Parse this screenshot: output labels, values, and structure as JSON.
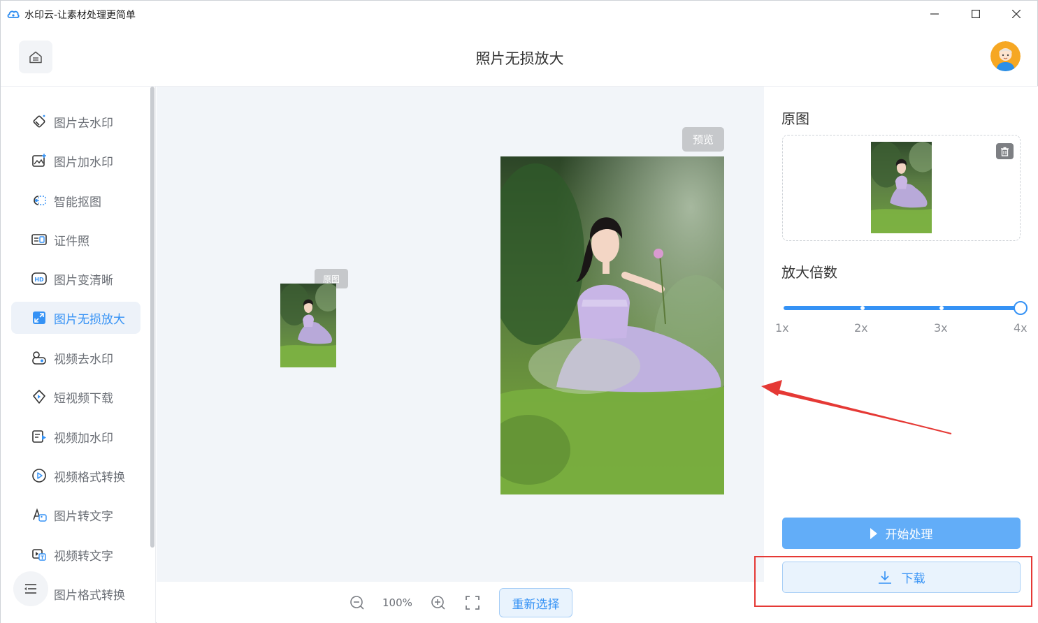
{
  "window": {
    "title": "水印云-让素材处理更简单",
    "controls": [
      "minimize-icon",
      "maximize-icon",
      "close-icon"
    ]
  },
  "header": {
    "title": "照片无损放大",
    "home_icon": "home-icon",
    "avatar": "user-avatar"
  },
  "sidebar": {
    "items": [
      {
        "label": "图片去水印",
        "icon": "eraser-icon",
        "active": false
      },
      {
        "label": "图片加水印",
        "icon": "image-add-icon",
        "active": false
      },
      {
        "label": "智能抠图",
        "icon": "cutout-icon",
        "active": false
      },
      {
        "label": "证件照",
        "icon": "id-card-icon",
        "active": false
      },
      {
        "label": "图片变清晰",
        "icon": "hd-icon",
        "active": false
      },
      {
        "label": "图片无损放大",
        "icon": "expand-icon",
        "active": true
      },
      {
        "label": "视频去水印",
        "icon": "video-eraser-icon",
        "active": false
      },
      {
        "label": "短视频下载",
        "icon": "video-download-icon",
        "active": false
      },
      {
        "label": "视频加水印",
        "icon": "video-add-icon",
        "active": false
      },
      {
        "label": "视频格式转换",
        "icon": "play-circle-icon",
        "active": false
      },
      {
        "label": "图片转文字",
        "icon": "image-text-icon",
        "active": false
      },
      {
        "label": "视频转文字",
        "icon": "video-text-icon",
        "active": false
      },
      {
        "label": "图片格式转换",
        "icon": "format-icon",
        "active": false
      }
    ],
    "menu_icon": "menu-icon"
  },
  "canvas": {
    "original_tag": "原图",
    "preview_tag": "预览"
  },
  "toolbar": {
    "zoom": "100%",
    "reselect_label": "重新选择"
  },
  "panel": {
    "original_title": "原图",
    "scale_title": "放大倍数",
    "scale_options": [
      "1x",
      "2x",
      "3x",
      "4x"
    ],
    "scale_selected": "4x",
    "start_label": "开始处理",
    "download_label": "下载"
  },
  "colors": {
    "accent": "#3592f5",
    "annotation": "#e53935"
  }
}
